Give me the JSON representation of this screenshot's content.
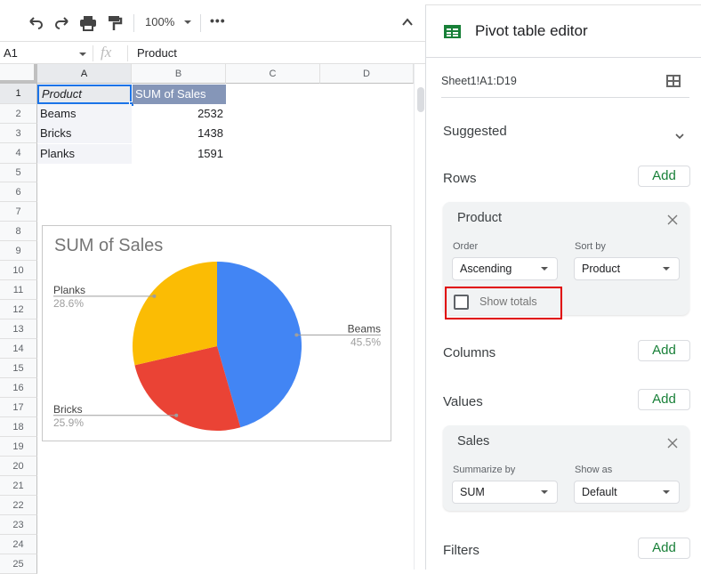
{
  "toolbar": {
    "zoom": "100%",
    "icons": [
      "undo-icon",
      "redo-icon",
      "print-icon",
      "paint-format-icon",
      "more-icon",
      "collapse-icon"
    ],
    "more_label": "•••"
  },
  "formula_bar": {
    "name_box": "A1",
    "fx_label": "fx",
    "value": "Product"
  },
  "columns": [
    "A",
    "B",
    "C",
    "D"
  ],
  "rows": [
    "1",
    "2",
    "3",
    "4",
    "5",
    "6",
    "7",
    "8",
    "9",
    "10",
    "11",
    "12",
    "13",
    "14",
    "15",
    "16",
    "17",
    "18",
    "19",
    "20",
    "21",
    "22",
    "23",
    "24",
    "25"
  ],
  "cells": {
    "A1": "Product",
    "B1": "SUM of Sales",
    "A2": "Beams",
    "B2": "2532",
    "A3": "Bricks",
    "B3": "1438",
    "A4": "Planks",
    "B4": "1591"
  },
  "colors": {
    "beams": "#4285f4",
    "bricks": "#ea4335",
    "planks": "#fbbc04",
    "header_fill": "#8596b8",
    "add_green": "#188038",
    "highlight_red": "#e00000",
    "sheets_green": "#188038"
  },
  "chart_data": {
    "type": "pie",
    "title": "SUM of Sales",
    "categories": [
      "Beams",
      "Bricks",
      "Planks"
    ],
    "values": [
      2532,
      1438,
      1591
    ],
    "percent_labels": [
      "45.5%",
      "25.9%",
      "28.6%"
    ],
    "legend": "labeled slices",
    "colors": [
      "#4285f4",
      "#ea4335",
      "#fbbc04"
    ]
  },
  "panel": {
    "title": "Pivot table editor",
    "range": "Sheet1!A1:D19",
    "suggested": "Suggested",
    "rows_label": "Rows",
    "columns_label": "Columns",
    "values_label": "Values",
    "filters_label": "Filters",
    "add_label": "Add",
    "row_card": {
      "title": "Product",
      "order_label": "Order",
      "order_value": "Ascending",
      "sortby_label": "Sort by",
      "sortby_value": "Product",
      "show_totals_label": "Show totals",
      "show_totals_checked": false
    },
    "value_card": {
      "title": "Sales",
      "summarize_label": "Summarize by",
      "summarize_value": "SUM",
      "showas_label": "Show as",
      "showas_value": "Default"
    }
  }
}
